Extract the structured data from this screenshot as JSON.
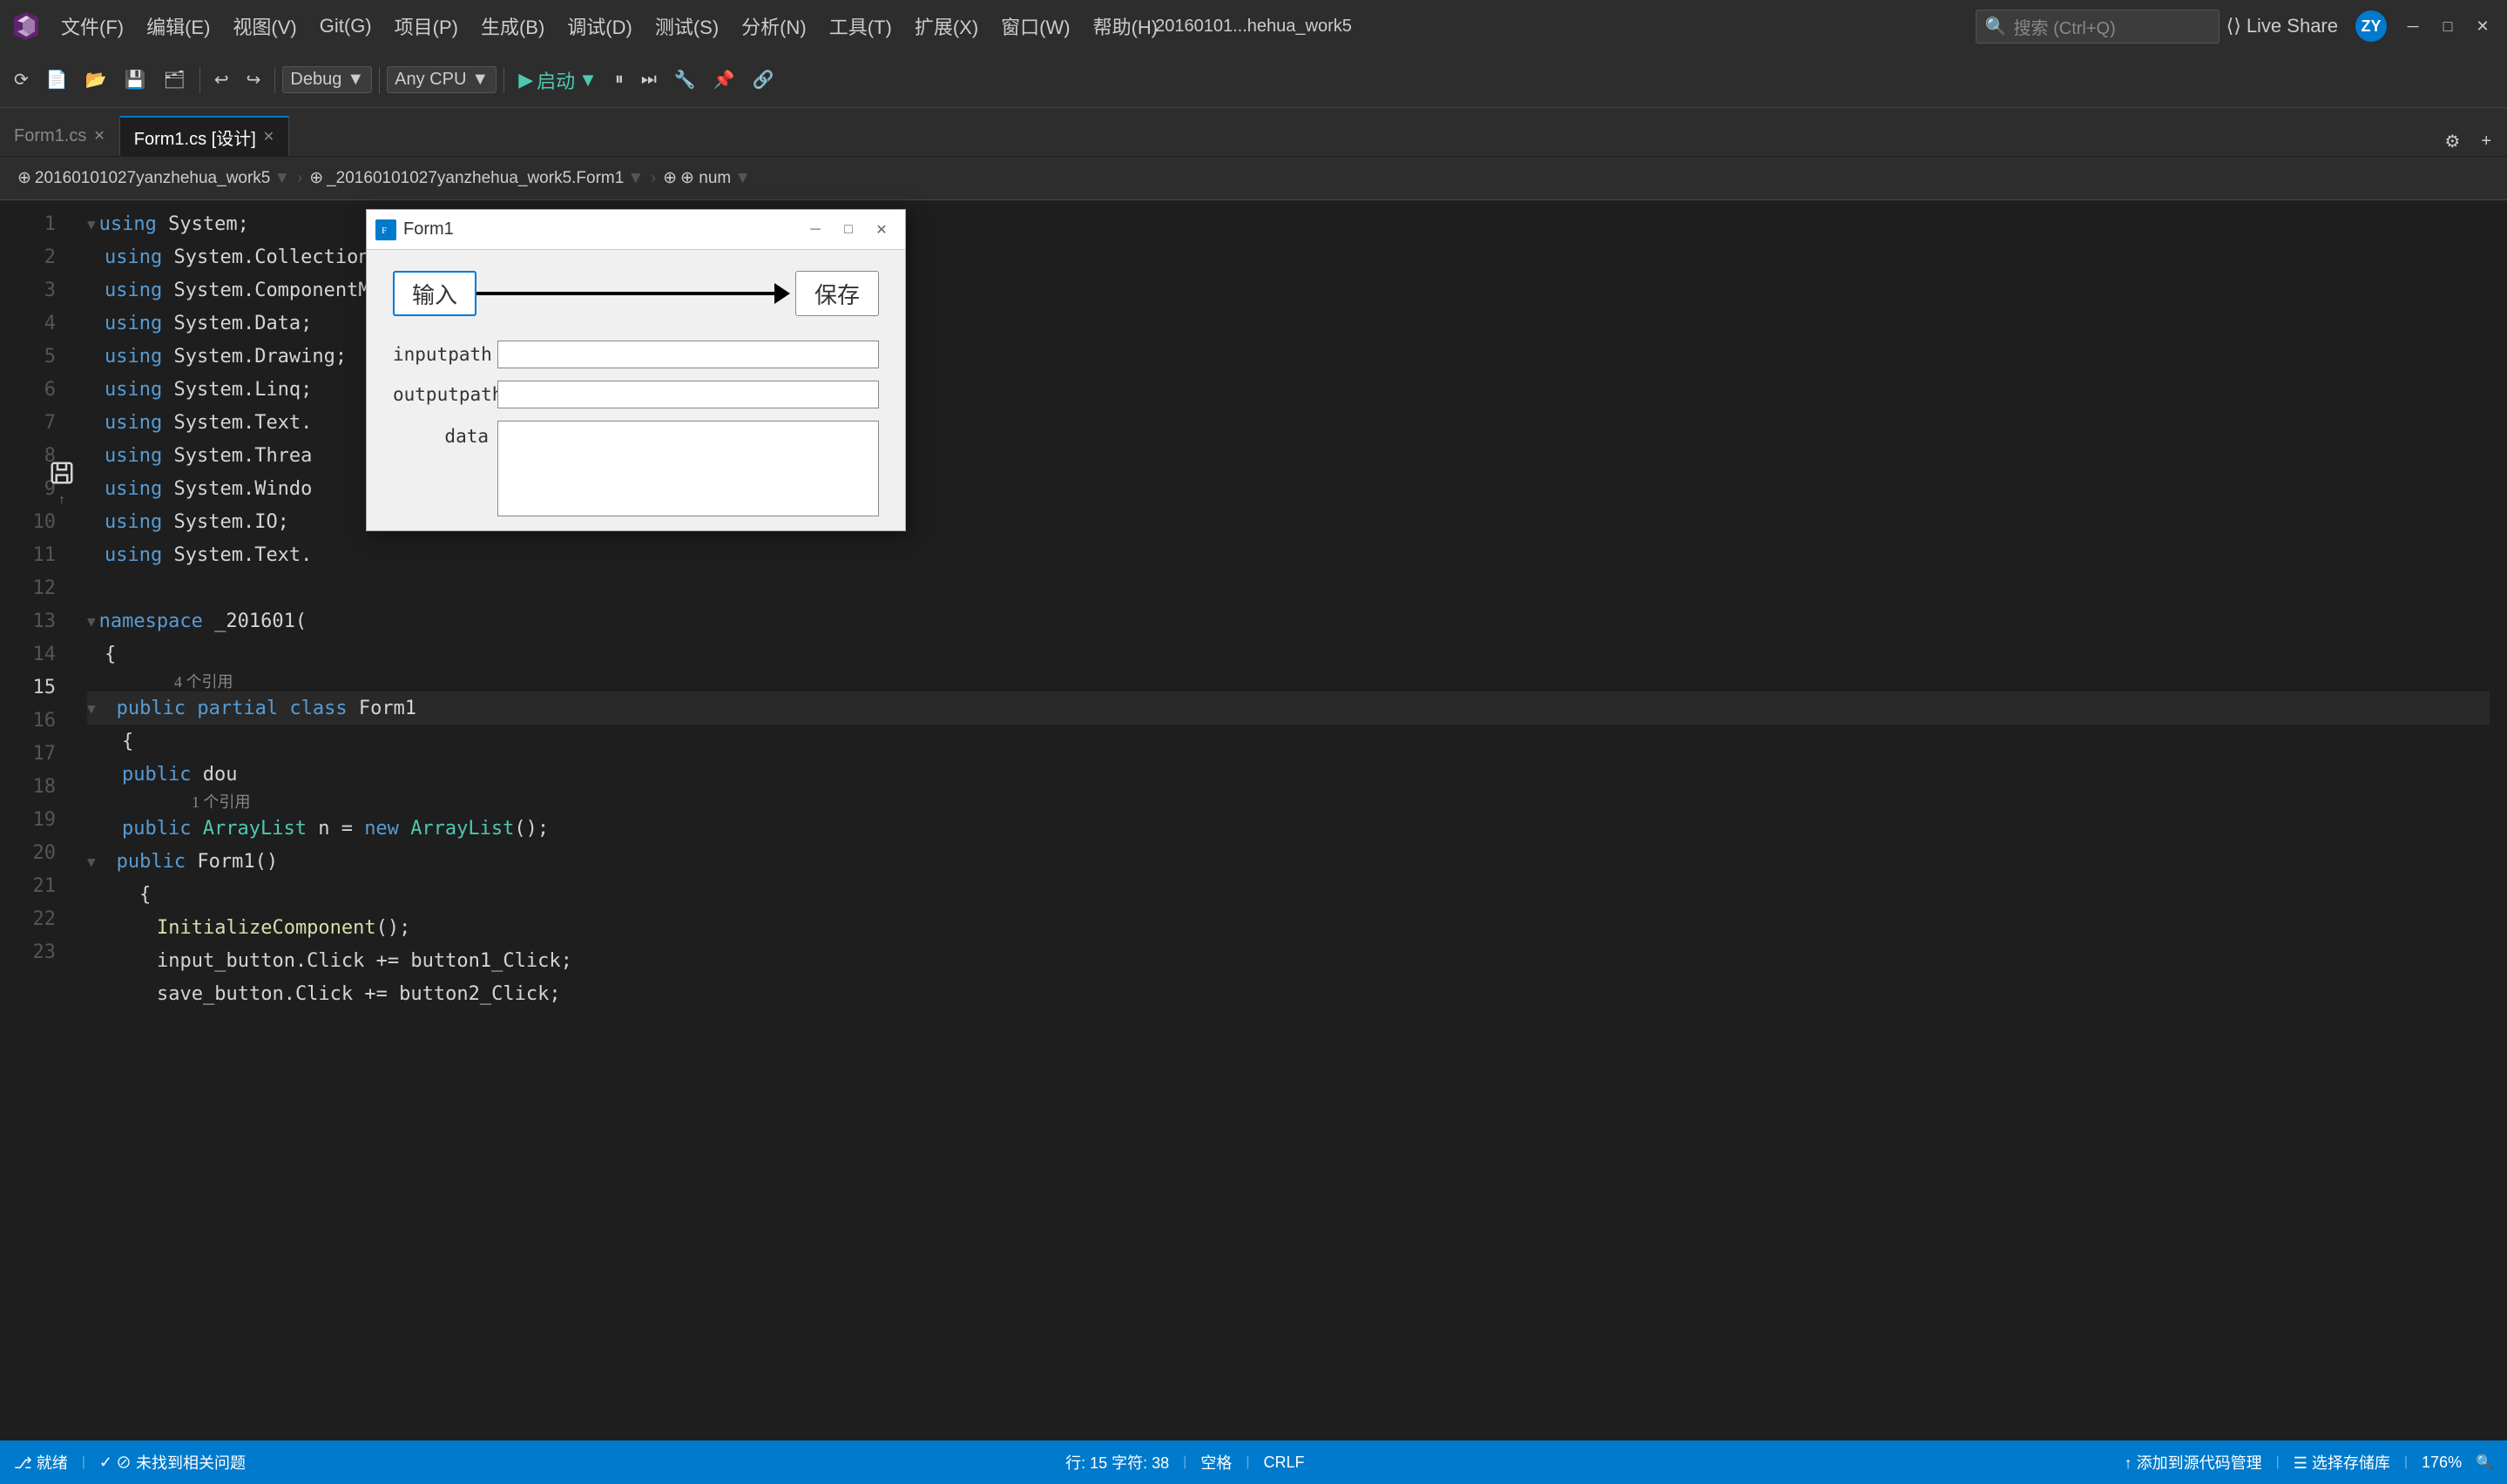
{
  "titlebar": {
    "menu_items": [
      "文件(F)",
      "编辑(E)",
      "视图(V)",
      "Git(G)",
      "项目(P)",
      "生成(B)",
      "调试(D)",
      "测试(S)",
      "分析(N)",
      "工具(T)",
      "扩展(X)",
      "窗口(W)",
      "帮助(H)"
    ],
    "search_placeholder": "搜索 (Ctrl+Q)",
    "project_name": "20160101...hehua_work5",
    "live_share_label": "Live Share"
  },
  "toolbar": {
    "debug_config": "Debug",
    "cpu_config": "Any CPU",
    "start_label": "启动",
    "undo_label": "↩",
    "redo_label": "↪"
  },
  "tabs": [
    {
      "name": "Form1.cs",
      "active": false
    },
    {
      "name": "Form1.cs [设计]",
      "active": true
    }
  ],
  "pathbar": {
    "project": "⊕ 20160101027yanzhehua_work5",
    "class": "⊕_20160101027yanzhehua_work5.Form1",
    "member": "⊕ num"
  },
  "code_lines": [
    {
      "num": 1,
      "text": "using System;",
      "fold": "▼"
    },
    {
      "num": 2,
      "text": "    using System.Collections;"
    },
    {
      "num": 3,
      "text": "    using System.ComponentModel;"
    },
    {
      "num": 4,
      "text": "    using System.Data;"
    },
    {
      "num": 5,
      "text": "    using System.Drawing;"
    },
    {
      "num": 6,
      "text": "    using System.Linq;"
    },
    {
      "num": 7,
      "text": "    using System.Text."
    },
    {
      "num": 8,
      "text": "    using System.Threa"
    },
    {
      "num": 9,
      "text": "    using System.Windo"
    },
    {
      "num": 10,
      "text": "    using System.IO;"
    },
    {
      "num": 11,
      "text": "    using System.Text."
    },
    {
      "num": 12,
      "text": ""
    },
    {
      "num": 13,
      "text": "    namespace _201601(",
      "fold": "▼"
    },
    {
      "num": 14,
      "text": "    {"
    },
    {
      "num": 15,
      "text": "        public partia",
      "fold": "▼",
      "ref_count": "4 个引用"
    },
    {
      "num": 16,
      "text": "        {"
    },
    {
      "num": 17,
      "text": "            public dou"
    },
    {
      "num": 18,
      "text": "            public ArrayList n = new ArrayList();",
      "ref_count": "1 个引用"
    },
    {
      "num": 19,
      "text": "            public Form1()",
      "fold": "▼"
    },
    {
      "num": 20,
      "text": "            {"
    },
    {
      "num": 21,
      "text": "                InitializeComponent();"
    },
    {
      "num": 22,
      "text": "                input_button.Click += button1_Click;"
    },
    {
      "num": 23,
      "text": "                save_button.Click += button2_Click;"
    }
  ],
  "dialog": {
    "title": "Form1",
    "input_button_label": "输入",
    "save_button_label": "保存",
    "inputpath_label": "inputpath",
    "outputpath_label": "outputpath",
    "data_label": "data",
    "inputpath_value": "",
    "outputpath_value": "",
    "data_value": ""
  },
  "statusbar": {
    "git": "⎇ 就绪",
    "errors": "⊘ 未找到相关问题",
    "position": "行: 15  字符: 38",
    "space": "空格",
    "encoding": "CRLF",
    "add_code": "↑ 添加到源代码管理",
    "select_repo": "☰ 选择存储库",
    "zoom": "176%"
  },
  "window_controls": {
    "minimize": "─",
    "maximize": "□",
    "close": "✕"
  },
  "dialog_controls": {
    "minimize": "─",
    "maximize": "□",
    "close": "✕"
  }
}
